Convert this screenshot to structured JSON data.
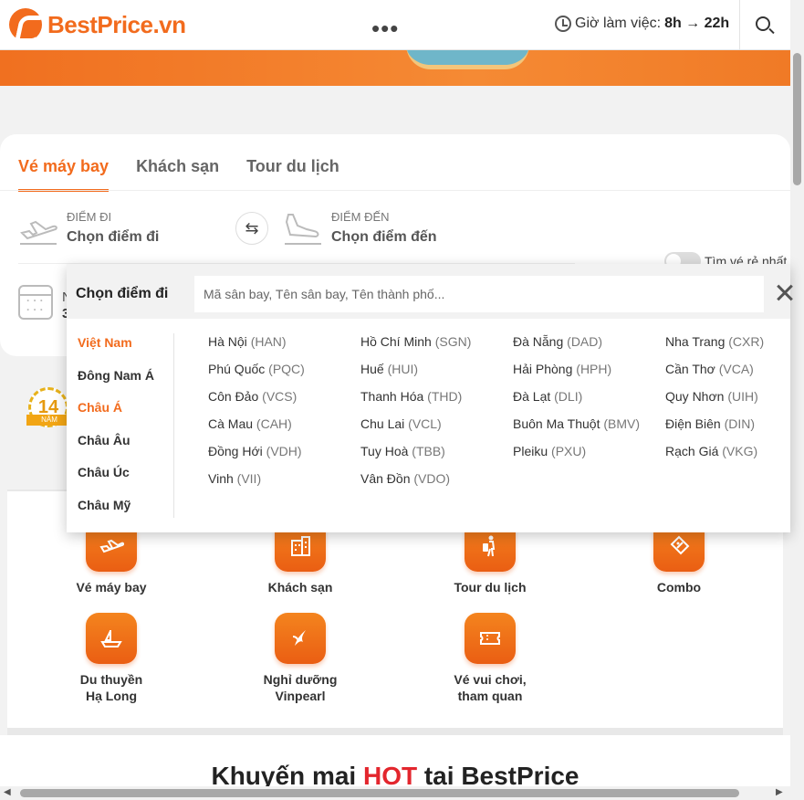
{
  "header": {
    "logo_text": "BestPrice.vn",
    "more_dots": "•••",
    "hours_label": "Giờ làm việc:",
    "hours_value": "8h → 22h"
  },
  "search_card": {
    "tabs": [
      "Vé máy bay",
      "Khách sạn",
      "Tour du lịch"
    ],
    "origin_label": "ĐIỂM ĐI",
    "origin_value": "Chọn điểm đi",
    "destination_label": "ĐIỂM ĐẾN",
    "destination_value": "Chọn điểm đến",
    "swap_icon": "⇆",
    "cheapest_toggle_label": "Tìm vé rẻ nhất",
    "date_label_peek": "N",
    "date_value_peek": "3"
  },
  "badge": {
    "number": "14",
    "ribbon": "NĂM"
  },
  "dropdown": {
    "title": "Chọn điểm đi",
    "search_placeholder": "Mã sân bay, Tên sân bay, Tên thành phố...",
    "regions": [
      "Việt Nam",
      "Đông Nam Á",
      "Châu Á",
      "Châu Âu",
      "Châu Úc",
      "Châu Mỹ"
    ],
    "airports": [
      {
        "city": "Hà Nội",
        "code": "(HAN)"
      },
      {
        "city": "Hồ Chí Minh",
        "code": "(SGN)"
      },
      {
        "city": "Đà Nẵng",
        "code": "(DAD)"
      },
      {
        "city": "Nha Trang",
        "code": "(CXR)"
      },
      {
        "city": "Phú Quốc",
        "code": "(PQC)"
      },
      {
        "city": "Huế",
        "code": "(HUI)"
      },
      {
        "city": "Hải Phòng",
        "code": "(HPH)"
      },
      {
        "city": "Cần Thơ",
        "code": "(VCA)"
      },
      {
        "city": "Côn Đảo",
        "code": "(VCS)"
      },
      {
        "city": "Thanh Hóa",
        "code": "(THD)"
      },
      {
        "city": "Đà Lạt",
        "code": "(DLI)"
      },
      {
        "city": "Quy Nhơn",
        "code": "(UIH)"
      },
      {
        "city": "Cà Mau",
        "code": "(CAH)"
      },
      {
        "city": "Chu Lai",
        "code": "(VCL)"
      },
      {
        "city": "Buôn Ma Thuột",
        "code": "(BMV)"
      },
      {
        "city": "Điện Biên",
        "code": "(DIN)"
      },
      {
        "city": "Đồng Hới",
        "code": "(VDH)"
      },
      {
        "city": "Tuy Hoà",
        "code": "(TBB)"
      },
      {
        "city": "Pleiku",
        "code": "(PXU)"
      },
      {
        "city": "Rạch Giá",
        "code": "(VKG)"
      },
      {
        "city": "Vinh",
        "code": "(VII)"
      },
      {
        "city": "Vân Đồn",
        "code": "(VDO)"
      }
    ]
  },
  "services": [
    {
      "label": "Vé máy bay",
      "icon": "plane-icon"
    },
    {
      "label": "Khách sạn",
      "icon": "hotel-icon"
    },
    {
      "label": "Tour du lịch",
      "icon": "traveler-icon"
    },
    {
      "label": "Combo",
      "icon": "ticket-tag-icon"
    },
    {
      "label": "Du thuyền\nHạ Long",
      "icon": "boat-icon"
    },
    {
      "label": "Nghỉ dưỡng\nVinpearl",
      "icon": "vinpearl-icon"
    },
    {
      "label": "Vé vui chơi,\ntham quan",
      "icon": "ticket-icon"
    }
  ],
  "promo": {
    "prefix": "Khuyến mại ",
    "hot": "HOT",
    "suffix": " tại BestPrice"
  },
  "colors": {
    "brand": "#f26b1d",
    "hot": "#e3262d"
  }
}
